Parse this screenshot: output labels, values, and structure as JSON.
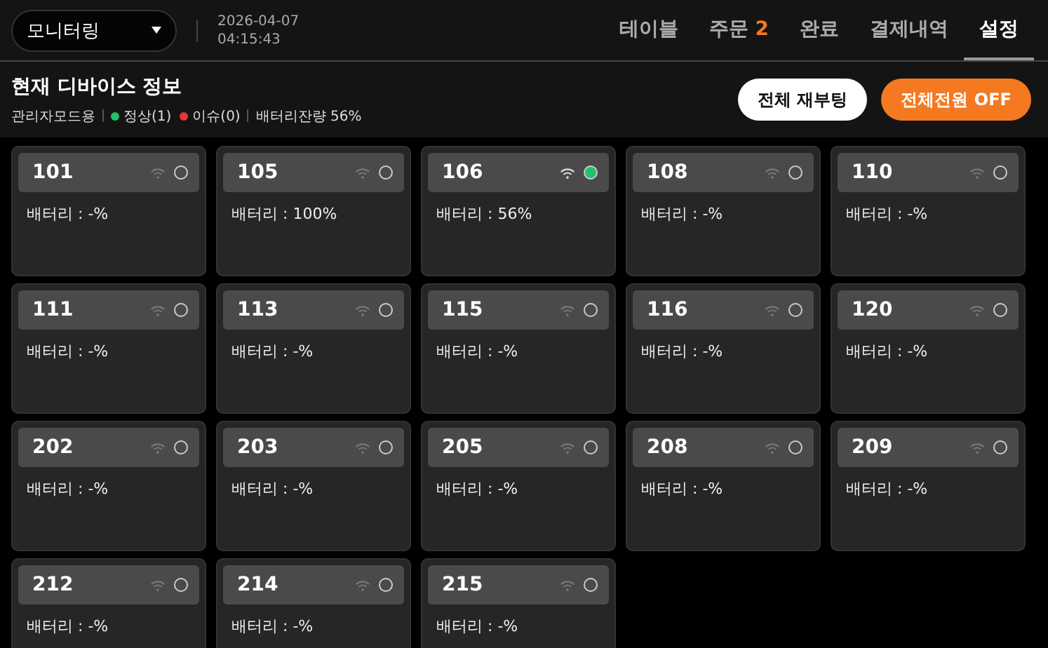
{
  "mode_select": {
    "value": "모니터링"
  },
  "date": "2026-04-07",
  "time": "04:15:43",
  "tabs": [
    {
      "label": "테이블",
      "selected": false
    },
    {
      "label": "주문",
      "badge": "2",
      "selected": false
    },
    {
      "label": "완료",
      "selected": false
    },
    {
      "label": "결제내역",
      "selected": false
    },
    {
      "label": "설정",
      "selected": true
    }
  ],
  "info": {
    "title": "현재 디바이스 정보",
    "mode": "관리자모드용",
    "normal": "정상(1)",
    "issue": "이슈(0)",
    "battery": "배터리잔량 56%"
  },
  "buttons": [
    {
      "label": "전체 재부팅",
      "kind": "secondary"
    },
    {
      "label": "전체전원 OFF",
      "kind": "primary"
    }
  ],
  "devices": [
    {
      "name": "101",
      "battery": "배터리 : -%",
      "online": false
    },
    {
      "name": "105",
      "battery": "배터리 : 100%",
      "online": false
    },
    {
      "name": "106",
      "battery": "배터리 : 56%",
      "online": true
    },
    {
      "name": "108",
      "battery": "배터리 : -%",
      "online": false
    },
    {
      "name": "110",
      "battery": "배터리 : -%",
      "online": false
    },
    {
      "name": "111",
      "battery": "배터리 : -%",
      "online": false
    },
    {
      "name": "113",
      "battery": "배터리 : -%",
      "online": false
    },
    {
      "name": "115",
      "battery": "배터리 : -%",
      "online": false
    },
    {
      "name": "116",
      "battery": "배터리 : -%",
      "online": false
    },
    {
      "name": "120",
      "battery": "배터리 : -%",
      "online": false
    },
    {
      "name": "202",
      "battery": "배터리 : -%",
      "online": false
    },
    {
      "name": "203",
      "battery": "배터리 : -%",
      "online": false
    },
    {
      "name": "205",
      "battery": "배터리 : -%",
      "online": false
    },
    {
      "name": "208",
      "battery": "배터리 : -%",
      "online": false
    },
    {
      "name": "209",
      "battery": "배터리 : -%",
      "online": false
    },
    {
      "name": "212",
      "battery": "배터리 : -%",
      "online": false
    },
    {
      "name": "214",
      "battery": "배터리 : -%",
      "online": false
    },
    {
      "name": "215",
      "battery": "배터리 : -%",
      "online": false
    }
  ]
}
